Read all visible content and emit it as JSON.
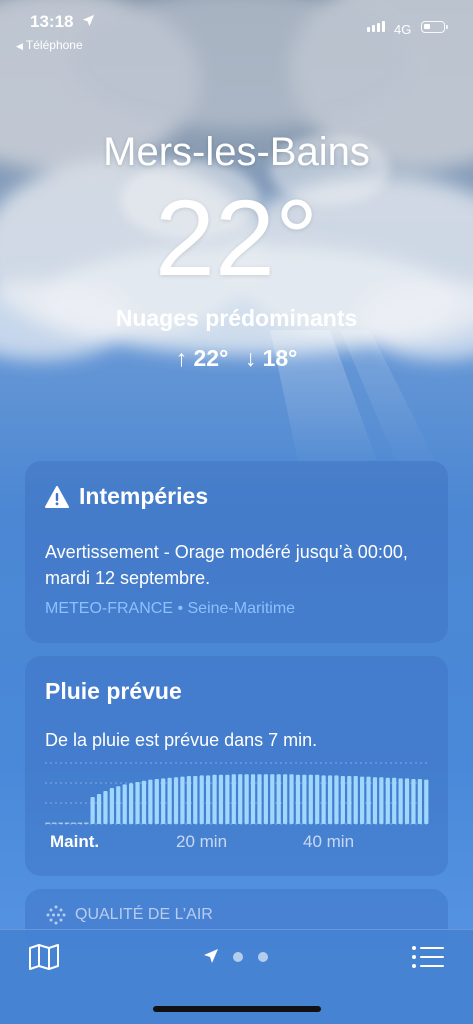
{
  "status_bar": {
    "time": "13:18",
    "back_label": "Téléphone",
    "network": "4G",
    "battery_level": 0.35
  },
  "weather": {
    "city": "Mers-les-Bains",
    "temperature": "22°",
    "condition": "Nuages prédominants",
    "high": "↑ 22°",
    "low": "↓ 18°"
  },
  "alert_card": {
    "title": "Intempéries",
    "text": "Avertissement - Orage modéré jusqu’à 00:00, mardi 12 septembre.",
    "source": "METEO-FRANCE • Seine-Maritime",
    "icon": "warning-triangle-icon"
  },
  "rain_card": {
    "title": "Pluie prévue",
    "text": "De la pluie est prévue dans 7 min.",
    "ticks": {
      "now": "Maint.",
      "t20": "20 min",
      "t40": "40 min"
    }
  },
  "air_quality": {
    "label": "QUALITÉ DE L’AIR",
    "icon": "air-quality-icon"
  },
  "bottom_bar": {
    "icons": [
      "map-icon",
      "location-arrow-icon",
      "page-dot",
      "page-dot",
      "list-icon"
    ]
  },
  "colors": {
    "sky_top": "#8b9db3",
    "sky_bottom": "#4a89d9",
    "card_bg": "#3c6ebe",
    "source_text": "#8ec0ff",
    "rain_bar": "#9fd7ff"
  },
  "chart_data": {
    "type": "bar",
    "title": "",
    "x_unit": "min",
    "x": [
      0,
      1,
      2,
      3,
      4,
      5,
      6,
      7,
      8,
      9,
      10,
      11,
      12,
      13,
      14,
      15,
      16,
      17,
      18,
      19,
      20,
      21,
      22,
      23,
      24,
      25,
      26,
      27,
      28,
      29,
      30,
      31,
      32,
      33,
      34,
      35,
      36,
      37,
      38,
      39,
      40,
      41,
      42,
      43,
      44,
      45,
      46,
      47,
      48,
      49,
      50,
      51,
      52,
      53,
      54,
      55,
      56,
      57,
      58,
      59
    ],
    "values": [
      0,
      0,
      0,
      0,
      0,
      0,
      0,
      0.45,
      0.5,
      0.55,
      0.6,
      0.63,
      0.66,
      0.68,
      0.7,
      0.72,
      0.74,
      0.75,
      0.76,
      0.77,
      0.78,
      0.79,
      0.8,
      0.8,
      0.81,
      0.81,
      0.82,
      0.82,
      0.82,
      0.83,
      0.83,
      0.83,
      0.83,
      0.83,
      0.83,
      0.83,
      0.83,
      0.83,
      0.83,
      0.82,
      0.82,
      0.82,
      0.82,
      0.81,
      0.81,
      0.81,
      0.8,
      0.8,
      0.8,
      0.79,
      0.79,
      0.78,
      0.78,
      0.77,
      0.77,
      0.76,
      0.76,
      0.75,
      0.75,
      0.74
    ],
    "xticks": [
      "Maint.",
      "20 min",
      "40 min"
    ],
    "ylim": [
      0,
      1
    ]
  }
}
